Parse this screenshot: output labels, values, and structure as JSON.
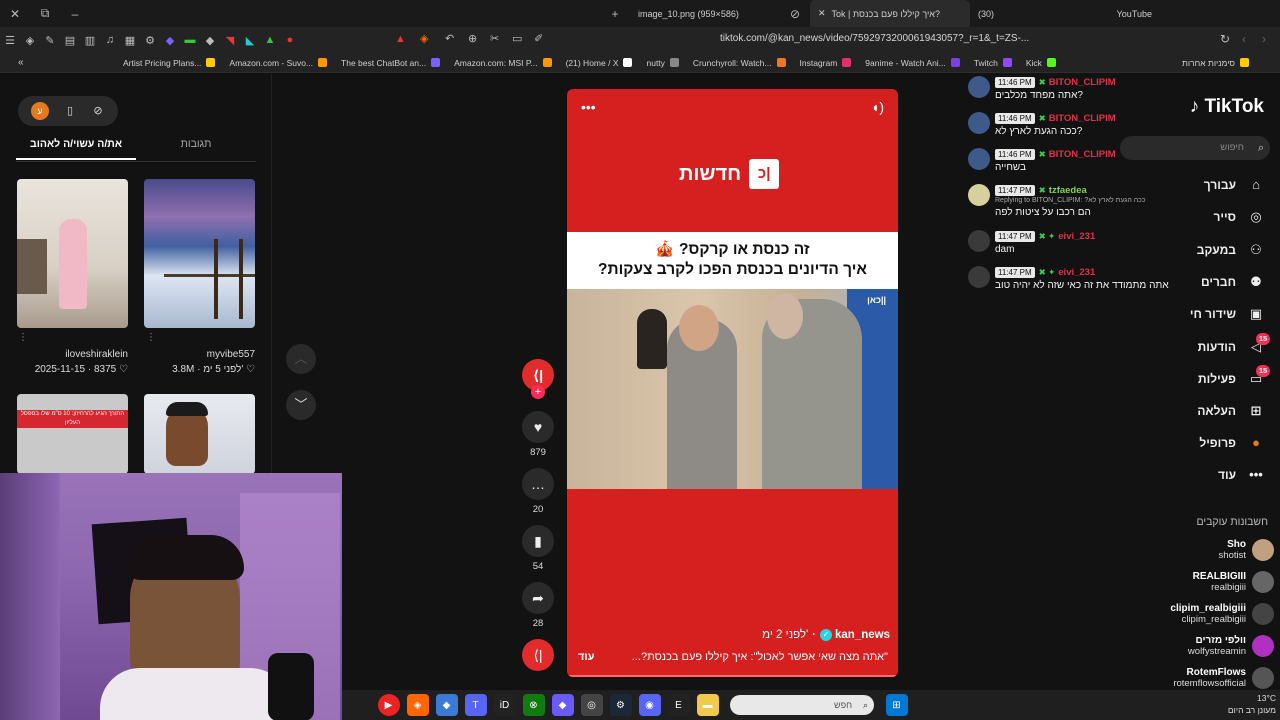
{
  "browser": {
    "tabs": [
      {
        "label": "image_10.png (959×586)"
      },
      {
        "label": "Tok | איך קיללו פעם בכנסת?"
      },
      {
        "label": "(30)"
      },
      {
        "label": "YouTube"
      }
    ],
    "url": "tiktok.com/@kan_news/video/7592973200061943057?_r=1&_t=ZS-...",
    "bookmarks": [
      {
        "label": "Artist Pricing Plans...",
        "color": "#ffcc00"
      },
      {
        "label": "Amazon.com - Suvo...",
        "color": "#ff9900"
      },
      {
        "label": "The best ChatBot an...",
        "color": "#7b61ff"
      },
      {
        "label": "Amazon.com: MSI P...",
        "color": "#ff9900"
      },
      {
        "label": "(21) Home / X",
        "color": "#ffffff"
      },
      {
        "label": "nutty",
        "color": "#888888"
      },
      {
        "label": "Crunchyroll: Watch...",
        "color": "#f47521"
      },
      {
        "label": "Instagram",
        "color": "#e1306c"
      },
      {
        "label": "9anime - Watch Ani...",
        "color": "#7b3fe4"
      },
      {
        "label": "Twitch",
        "color": "#9146ff"
      },
      {
        "label": "Kick",
        "color": "#53fc18"
      },
      {
        "label": "סימניות אחרות",
        "color": "#ffcc00"
      }
    ]
  },
  "left_panel": {
    "tabs": [
      "את/ה עשוי/ה לאהוב",
      "תגובות"
    ],
    "avatar_letter": "ע",
    "thumbs": [
      {
        "user": "iloveshiraklein",
        "date": "2025-11-15",
        "likes": "8375"
      },
      {
        "user": "myvibe557",
        "date": "לפני 5 ימ'",
        "likes": "3.8M"
      }
    ],
    "promo_text": "התורך הגיע להרחיזון: 10 ס\"מ שלו בספסל העליון"
  },
  "video": {
    "logo_text": "חדשות",
    "logo_mark": "כ|",
    "headline_line1": "זה כנסת או קרקס? 🎪",
    "headline_line2": "איך הדיונים בכנסת הפכו לקרב צעקות?",
    "watermark": "כאן||",
    "username": "kan_news",
    "posted": "לפני 2 ימ'",
    "caption": "\"אתה מצה שאי אפשר לאכול\": איך קיללו פעם בכנסת?...",
    "more": "עוד",
    "menu_icon": "more-horizontal-icon",
    "sound_icon": "speaker-icon"
  },
  "actions": {
    "likes": "879",
    "comments": "20",
    "saves": "54",
    "shares": "28"
  },
  "right_nav": {
    "logo": "TikTok",
    "search_placeholder": "חיפוש",
    "items": [
      {
        "label": "עבורך",
        "icon": "home-icon"
      },
      {
        "label": "סייר",
        "icon": "compass-icon"
      },
      {
        "label": "במעקב",
        "icon": "user-plus-icon"
      },
      {
        "label": "חברים",
        "icon": "friends-icon"
      },
      {
        "label": "שידור חי",
        "icon": "live-icon"
      },
      {
        "label": "הודעות",
        "icon": "message-icon",
        "badge": "15"
      },
      {
        "label": "פעילות",
        "icon": "activity-icon",
        "badge": "15"
      },
      {
        "label": "העלאה",
        "icon": "upload-icon"
      },
      {
        "label": "פרופיל",
        "icon": "profile-icon"
      },
      {
        "label": "עוד",
        "icon": "more-icon"
      }
    ],
    "following_header": "חשבונות עוקבים",
    "following": [
      {
        "name": "Sho",
        "handle": "shotist",
        "color": "#c0a080"
      },
      {
        "name": "REALBIGIII",
        "handle": "realbigiii",
        "color": "#666666"
      },
      {
        "name": "clipim_realbigiii",
        "handle": "clipim_realbigiii",
        "color": "#444444"
      },
      {
        "name": "וולפי מזרים",
        "handle": "wolfystreamin",
        "color": "#b030c0"
      },
      {
        "name": "RotemFlows",
        "handle": "rotemflowsofficial",
        "color": "#555555"
      }
    ]
  },
  "chat": {
    "messages": [
      {
        "time": "11:46 PM",
        "user": "BITON_CLIPIM",
        "user_color": "#e0314b",
        "text": "?אתה מפחד מכלבים"
      },
      {
        "time": "11:46 PM",
        "user": "BITON_CLIPIM",
        "user_color": "#e0314b",
        "text": "?ככה הגעת לארץ לא"
      },
      {
        "time": "11:46 PM",
        "user": "BITON_CLIPIM",
        "user_color": "#e0314b",
        "text": "בשחייה"
      },
      {
        "time": "11:47 PM",
        "user": "tzfaedea",
        "user_color": "#7cd84a",
        "reply": "Replying to BITON_CLIPIM: ?ככה הגעת לארץ לא",
        "text": "הם רכבו על ציטות לפה"
      },
      {
        "time": "11:47 PM",
        "user": "eivi_231",
        "user_color": "#e0314b",
        "text": "dam"
      },
      {
        "time": "11:47 PM",
        "user": "eivi_231",
        "user_color": "#e0314b",
        "text": "אתה מתמודד את זה כאי שזה לא יהיה טוב"
      }
    ]
  },
  "taskbar": {
    "search_placeholder": "חפש",
    "temperature": "13°C",
    "weather": "מעונן רב היום"
  }
}
